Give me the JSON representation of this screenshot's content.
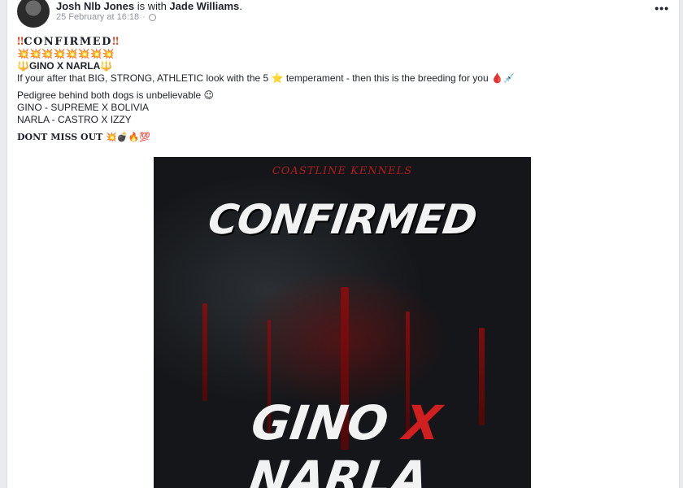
{
  "post": {
    "author": "Josh Nlb Jones",
    "with_text": " is with ",
    "tagged": "Jade Williams",
    "period": ".",
    "timestamp": "25 February at 16:18",
    "separator": "·",
    "privacy_icon": "globe-icon",
    "menu_label": "•••"
  },
  "body": {
    "line1_marks": "‼",
    "line1_text": "CONFIRMED",
    "line2_emoji": "💥💥💥💥💥💥💥💥",
    "line3_prefix": "🔱",
    "line3_text": "GINO X NARLA",
    "line3_suffix": "🔱",
    "line4_text": "If your after that BIG, STRONG, ATHLETIC look with the 5 ",
    "line4_star": "⭐",
    "line4_text2": " temperament - then this is the breeding for you ",
    "line4_emoji": "🩸💉",
    "line5_text": "Pedigree behind both dogs is unbelievable ",
    "line5_emoji": "😉",
    "line6_text": "GINO - SUPREME X BOLIVIA",
    "line7_text": "NARLA - CASTRO X IZZY",
    "line8_text": "DONT MISS OUT ",
    "line8_emoji": "💥💣🔥💯"
  },
  "image": {
    "brand": "COASTLINE KENNELS",
    "headline": "CONFIRMED",
    "footer_left": "GINO",
    "footer_x": "X",
    "footer_right": "NARLA"
  }
}
